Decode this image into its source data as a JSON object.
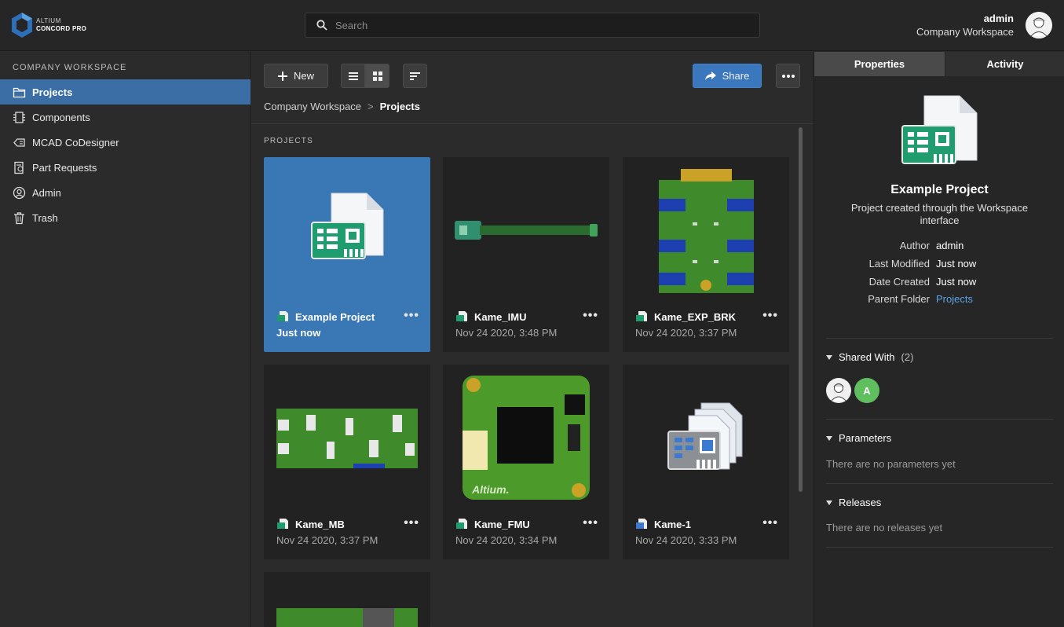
{
  "header": {
    "logo_line1": "ALTIUM",
    "logo_line2": "CONCORD PRO",
    "search_placeholder": "Search",
    "user_name": "admin",
    "user_workspace": "Company Workspace"
  },
  "sidebar": {
    "title": "COMPANY WORKSPACE",
    "items": [
      {
        "label": "Projects",
        "icon": "folder-icon",
        "active": true
      },
      {
        "label": "Components",
        "icon": "chip-icon"
      },
      {
        "label": "MCAD CoDesigner",
        "icon": "mcad-icon"
      },
      {
        "label": "Part Requests",
        "icon": "part-request-icon"
      },
      {
        "label": "Admin",
        "icon": "user-circle-icon"
      },
      {
        "label": "Trash",
        "icon": "trash-icon"
      }
    ]
  },
  "toolbar": {
    "new_label": "New",
    "share_label": "Share"
  },
  "breadcrumb": {
    "root": "Company Workspace",
    "separator": ">",
    "current": "Projects"
  },
  "main": {
    "section_label": "PROJECTS",
    "projects": [
      {
        "name": "Example Project",
        "date": "Just now",
        "selected": true
      },
      {
        "name": "Kame_IMU",
        "date": "Nov 24 2020, 3:48 PM"
      },
      {
        "name": "Kame_EXP_BRK",
        "date": "Nov 24 2020, 3:37 PM"
      },
      {
        "name": "Kame_MB",
        "date": "Nov 24 2020, 3:37 PM"
      },
      {
        "name": "Kame_FMU",
        "date": "Nov 24 2020, 3:34 PM"
      },
      {
        "name": "Kame-1",
        "date": "Nov 24 2020, 3:33 PM"
      }
    ]
  },
  "panel": {
    "tabs": [
      "Properties",
      "Activity"
    ],
    "title": "Example Project",
    "description": "Project created through the Workspace interface",
    "props": [
      {
        "key": "Author",
        "value": "admin"
      },
      {
        "key": "Last Modified",
        "value": "Just now"
      },
      {
        "key": "Date Created",
        "value": "Just now"
      },
      {
        "key": "Parent Folder",
        "value": "Projects"
      }
    ],
    "shared_with_label": "Shared With",
    "shared_with_count": "(2)",
    "shared_avatar_letter": "A",
    "parameters_label": "Parameters",
    "parameters_empty": "There are no parameters yet",
    "releases_label": "Releases",
    "releases_empty": "There are no releases yet"
  },
  "colors": {
    "accent": "#3a77bd",
    "selected_nav": "#3a6ea5",
    "link": "#5ba3e6",
    "pcb_green": "#1f9d6e"
  }
}
